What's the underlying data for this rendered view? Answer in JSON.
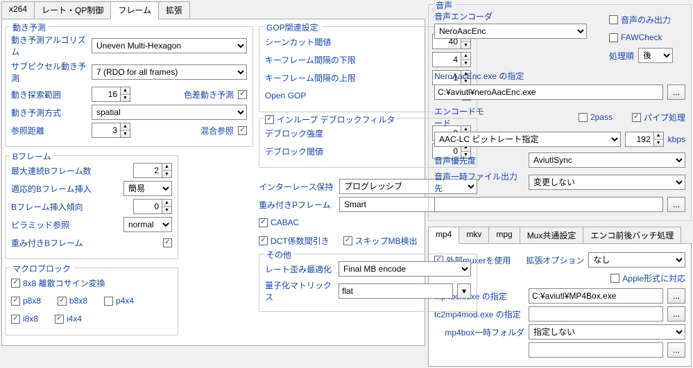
{
  "left": {
    "tabs": [
      "x264",
      "レート・QP制御",
      "フレーム",
      "拡張"
    ],
    "active_tab": "フレーム",
    "motion": {
      "legend": "動き予測",
      "algo_label": "動き予測アルゴリズム",
      "algo_value": "Uneven Multi-Hexagon",
      "subpixel_label": "サブピクセル動き予測",
      "subpixel_value": "7 (RDO for all frames)",
      "range_label": "動き探索範囲",
      "range_value": "16",
      "chroma_label": "色差動き予測",
      "method_label": "動き予測方式",
      "method_value": "spatial",
      "refdist_label": "参照距離",
      "refdist_value": "3",
      "mixref_label": "混合参照"
    },
    "bframe": {
      "legend": "Bフレーム",
      "maxb_label": "最大連続Bフレーム数",
      "maxb_value": "2",
      "adaptive_label": "適応的Bフレーム挿入",
      "adaptive_value": "簡易",
      "bias_label": "Bフレーム挿入傾向",
      "bias_value": "0",
      "pyramid_label": "ピラミッド参照",
      "pyramid_value": "normal",
      "weightb_label": "重み付きBフレーム"
    },
    "macroblock": {
      "legend": "マクロブロック",
      "dct8_label": "8x8 離散コサイン変換",
      "p8_label": "p8x8",
      "b8_label": "b8x8",
      "p4_label": "p4x4",
      "i8_label": "i8x8",
      "i4_label": "i4x4"
    },
    "gop": {
      "legend": "GOP関連設定",
      "scenecut_label": "シーンカット閾値",
      "scenecut_value": "40",
      "min_key_label": "キーフレーム間隔の下限",
      "min_key_value": "4",
      "max_key_label": "キーフレーム間隔の上限",
      "max_key_value": "-1",
      "opengop_label": "Open GOP"
    },
    "deblock": {
      "inloop_label": "インループ デブロックフィルタ",
      "strength_label": "デブロック強度",
      "strength_value": "0",
      "thresh_label": "デブロック閾値",
      "thresh_value": "0"
    },
    "interlace_label": "インターレース保持",
    "interlace_value": "プログレッシブ",
    "weightp_label": "重み付きPフレーム",
    "weightp_value": "Smart",
    "cabac_label": "CABAC",
    "dct_decimate_label": "DCT係数間引き",
    "skip_mb_label": "スキップMB検出",
    "other": {
      "legend": "その他",
      "rdo_label": "レート歪み最適化",
      "rdo_value": "Final MB encode",
      "qmat_label": "量子化マトリックス",
      "qmat_value": "flat"
    }
  },
  "right": {
    "audio": {
      "legend": "音声",
      "encoder_label": "音声エンコーダ",
      "encoder_value": "NeroAacEnc",
      "audioonly_label": "音声のみ出力",
      "fawcheck_label": "FAWCheck",
      "order_label": "処理順",
      "order_value": "後",
      "exe_label": "NeroAacEnc.exe の指定",
      "exe_value": "C:¥aviutl¥neroAacEnc.exe",
      "encmode_label": "エンコードモード",
      "encmode_value": "AAC-LC ビットレート指定",
      "twopass_label": "2pass",
      "pipe_label": "パイプ処理",
      "bitrate_value": "192",
      "bitrate_unit": "kbps",
      "priority_label": "音声優先度",
      "priority_value": "AviutlSync",
      "tempdir_label": "音声一時ファイル出力先",
      "tempdir_value": "変更しない",
      "tempdir_path": ""
    },
    "mux": {
      "tabs": [
        "mp4",
        "mkv",
        "mpg",
        "Mux共通設定",
        "エンコ前後バッチ処理"
      ],
      "active": "mp4",
      "ext_mux_label": "外部muxerを使用",
      "extopt_label": "拡張オプション",
      "extopt_value": "なし",
      "apple_label": "Apple形式に対応",
      "mp4box_label": "mp4box.exe の指定",
      "mp4box_value": "C:¥aviutl¥MP4Box.exe",
      "tc2mp4_label": "tc2mp4mod.exe の指定",
      "tc2mp4_value": "",
      "temp_label": "mp4box一時フォルダ",
      "temp_value": "指定しない",
      "temp_path": ""
    }
  }
}
